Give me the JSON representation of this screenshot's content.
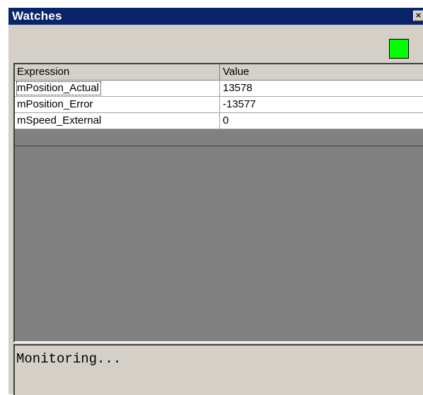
{
  "window": {
    "title": "Watches",
    "close_glyph": "×"
  },
  "indicator": {
    "name": "status-indicator",
    "color": "#00ff00"
  },
  "watches": {
    "columns": {
      "expression": "Expression",
      "value": "Value"
    },
    "rows": [
      {
        "expression": "mPosition_Actual",
        "value": "13578"
      },
      {
        "expression": "mPosition_Error",
        "value": "-13577"
      },
      {
        "expression": "mSpeed_External",
        "value": "0"
      }
    ]
  },
  "status": {
    "text": "Monitoring..."
  },
  "colors": {
    "title_bar": "#0a246a",
    "face": "#d4d0c8",
    "empty_area": "#808080"
  }
}
